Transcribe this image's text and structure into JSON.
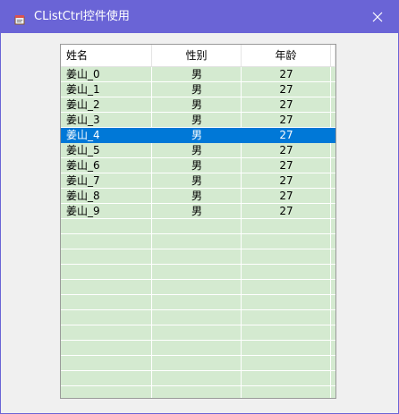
{
  "window": {
    "title": "CListCtrl控件使用",
    "icons": {
      "app": "app-icon",
      "close": "close-icon"
    }
  },
  "list": {
    "columns": [
      "姓名",
      "性别",
      "年龄"
    ],
    "rows": [
      {
        "name": "姜山_0",
        "gender": "男",
        "age": "27"
      },
      {
        "name": "姜山_1",
        "gender": "男",
        "age": "27"
      },
      {
        "name": "姜山_2",
        "gender": "男",
        "age": "27"
      },
      {
        "name": "姜山_3",
        "gender": "男",
        "age": "27"
      },
      {
        "name": "姜山_4",
        "gender": "男",
        "age": "27"
      },
      {
        "name": "姜山_5",
        "gender": "男",
        "age": "27"
      },
      {
        "name": "姜山_6",
        "gender": "男",
        "age": "27"
      },
      {
        "name": "姜山_7",
        "gender": "男",
        "age": "27"
      },
      {
        "name": "姜山_8",
        "gender": "男",
        "age": "27"
      },
      {
        "name": "姜山_9",
        "gender": "男",
        "age": "27"
      }
    ],
    "selected_index": 4
  },
  "colors": {
    "titlebar": "#6a64d6",
    "list_background": "#d4ead0",
    "selection": "#0078d7"
  }
}
